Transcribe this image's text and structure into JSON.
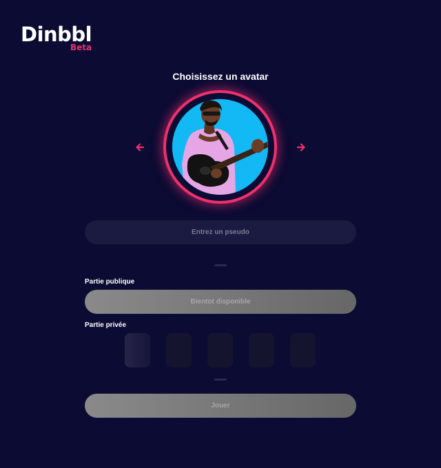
{
  "brand": {
    "name": "Dinbbl",
    "badge": "Beta"
  },
  "avatar": {
    "title": "Choisissez un avatar",
    "prev_icon": "arrow-left-icon",
    "next_icon": "arrow-right-icon"
  },
  "pseudo": {
    "placeholder": "Entrez un pseudo",
    "value": ""
  },
  "public_section": {
    "label": "Partie publique",
    "button_label": "Bientot disponible"
  },
  "private_section": {
    "label": "Partie privée",
    "code_boxes": [
      "",
      "",
      "",
      "",
      ""
    ]
  },
  "play_button": {
    "label": "Jouer"
  },
  "colors": {
    "background": "#0c0b33",
    "accent": "#f0306c",
    "avatar_bg": "#13b9f4",
    "disabled_button": "#7a7a7a"
  }
}
